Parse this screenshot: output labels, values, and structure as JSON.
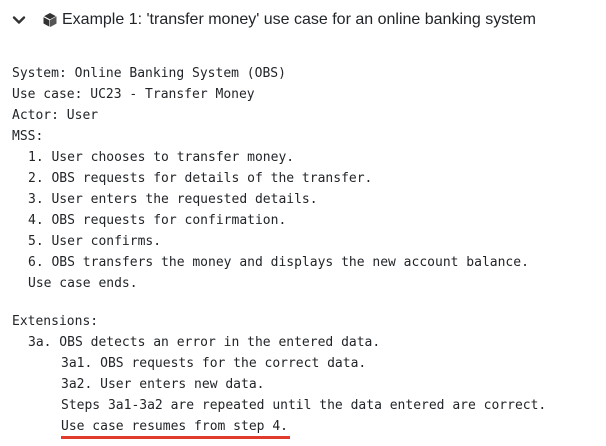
{
  "header": {
    "title": "Example 1: 'transfer money' use case for an online banking system",
    "toggle_icon": "chevron-down-icon",
    "title_icon": "cube-icon"
  },
  "usecase": {
    "system": "System: Online Banking System (OBS)",
    "use_case": "Use case: UC23 - Transfer Money",
    "actor": "Actor: User",
    "mss_label": "MSS:",
    "mss_steps": [
      "1. User chooses to transfer money.",
      "2. OBS requests for details of the transfer.",
      "3. User enters the requested details.",
      "4. OBS requests for confirmation.",
      "5. User confirms.",
      "6. OBS transfers the money and displays the new account balance."
    ],
    "mss_end": "Use case ends.",
    "extensions_label": "Extensions:",
    "extension_3a": "3a. OBS detects an error in the entered data.",
    "extension_3a_steps": [
      "3a1. OBS requests for the correct data.",
      "3a2. User enters new data.",
      "Steps 3a1-3a2 are repeated until the data entered are correct."
    ],
    "extension_3a_end": "Use case resumes from step 4.",
    "underline_color": "#e03b2d"
  }
}
